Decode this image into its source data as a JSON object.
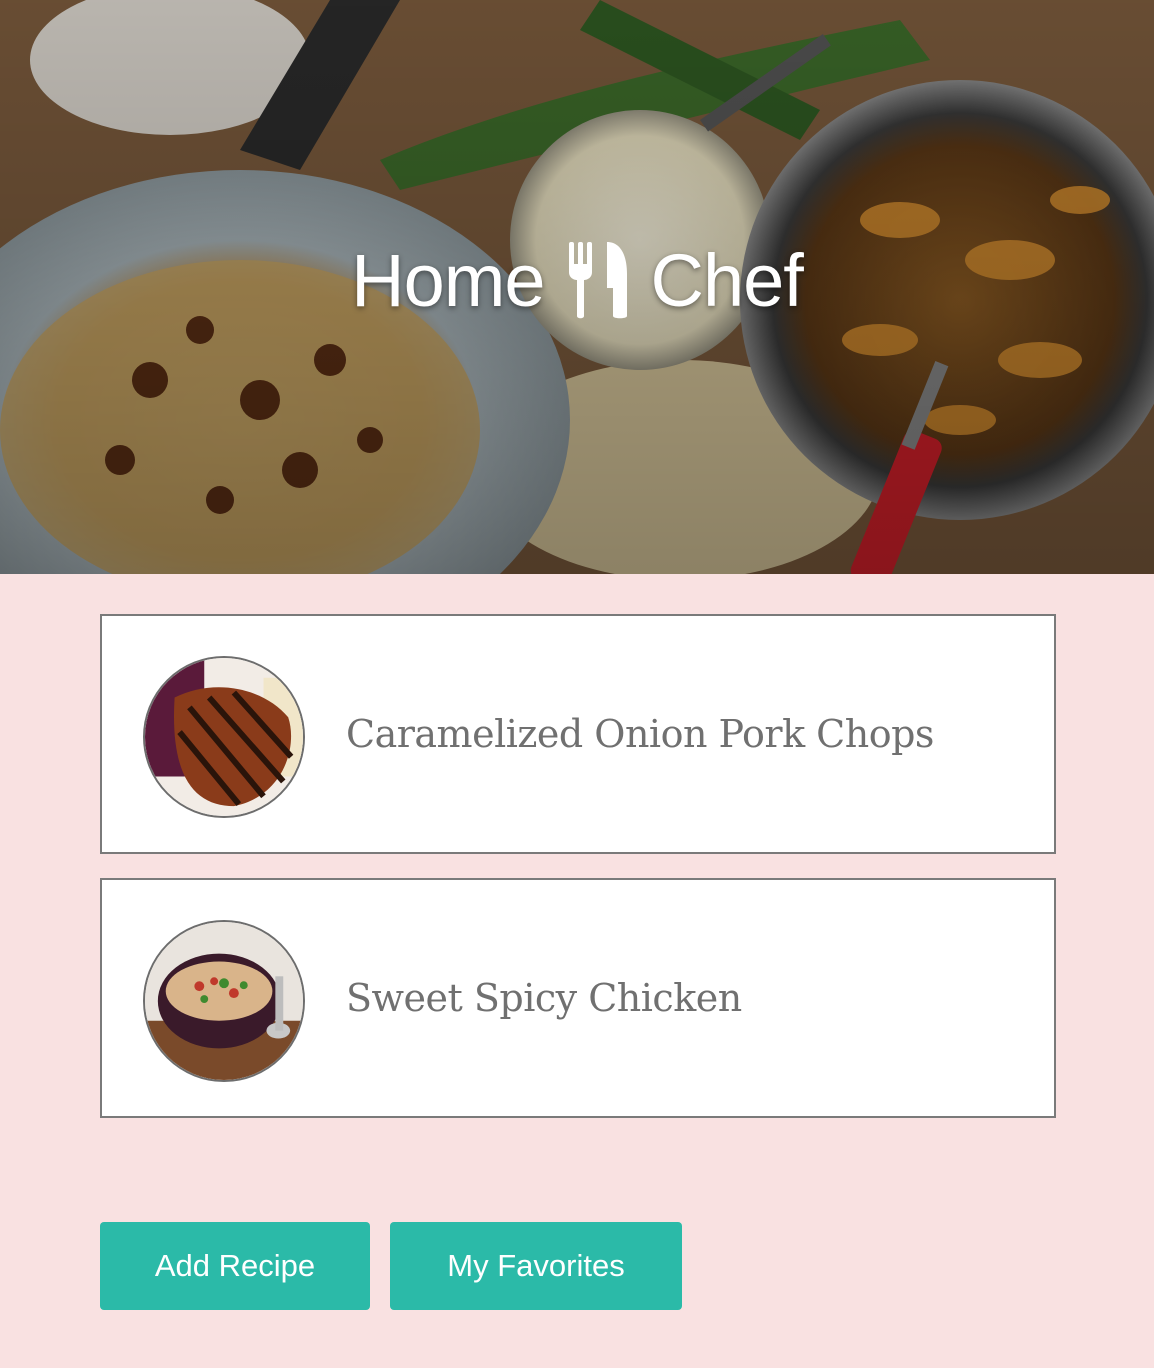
{
  "hero": {
    "title_left": "Home",
    "title_right": "Chef",
    "icon": "utensils-icon"
  },
  "recipes": [
    {
      "name": "Caramelized Onion Pork Chops",
      "thumbnail": "pork-chop-photo"
    },
    {
      "name": "Sweet Spicy Chicken",
      "thumbnail": "chicken-bowl-photo"
    }
  ],
  "actions": {
    "add_recipe": "Add Recipe",
    "my_favorites": "My Favorites"
  },
  "colors": {
    "page_background": "#f9e1e1",
    "button": "#2bbaa8",
    "recipe_text": "#707070"
  }
}
